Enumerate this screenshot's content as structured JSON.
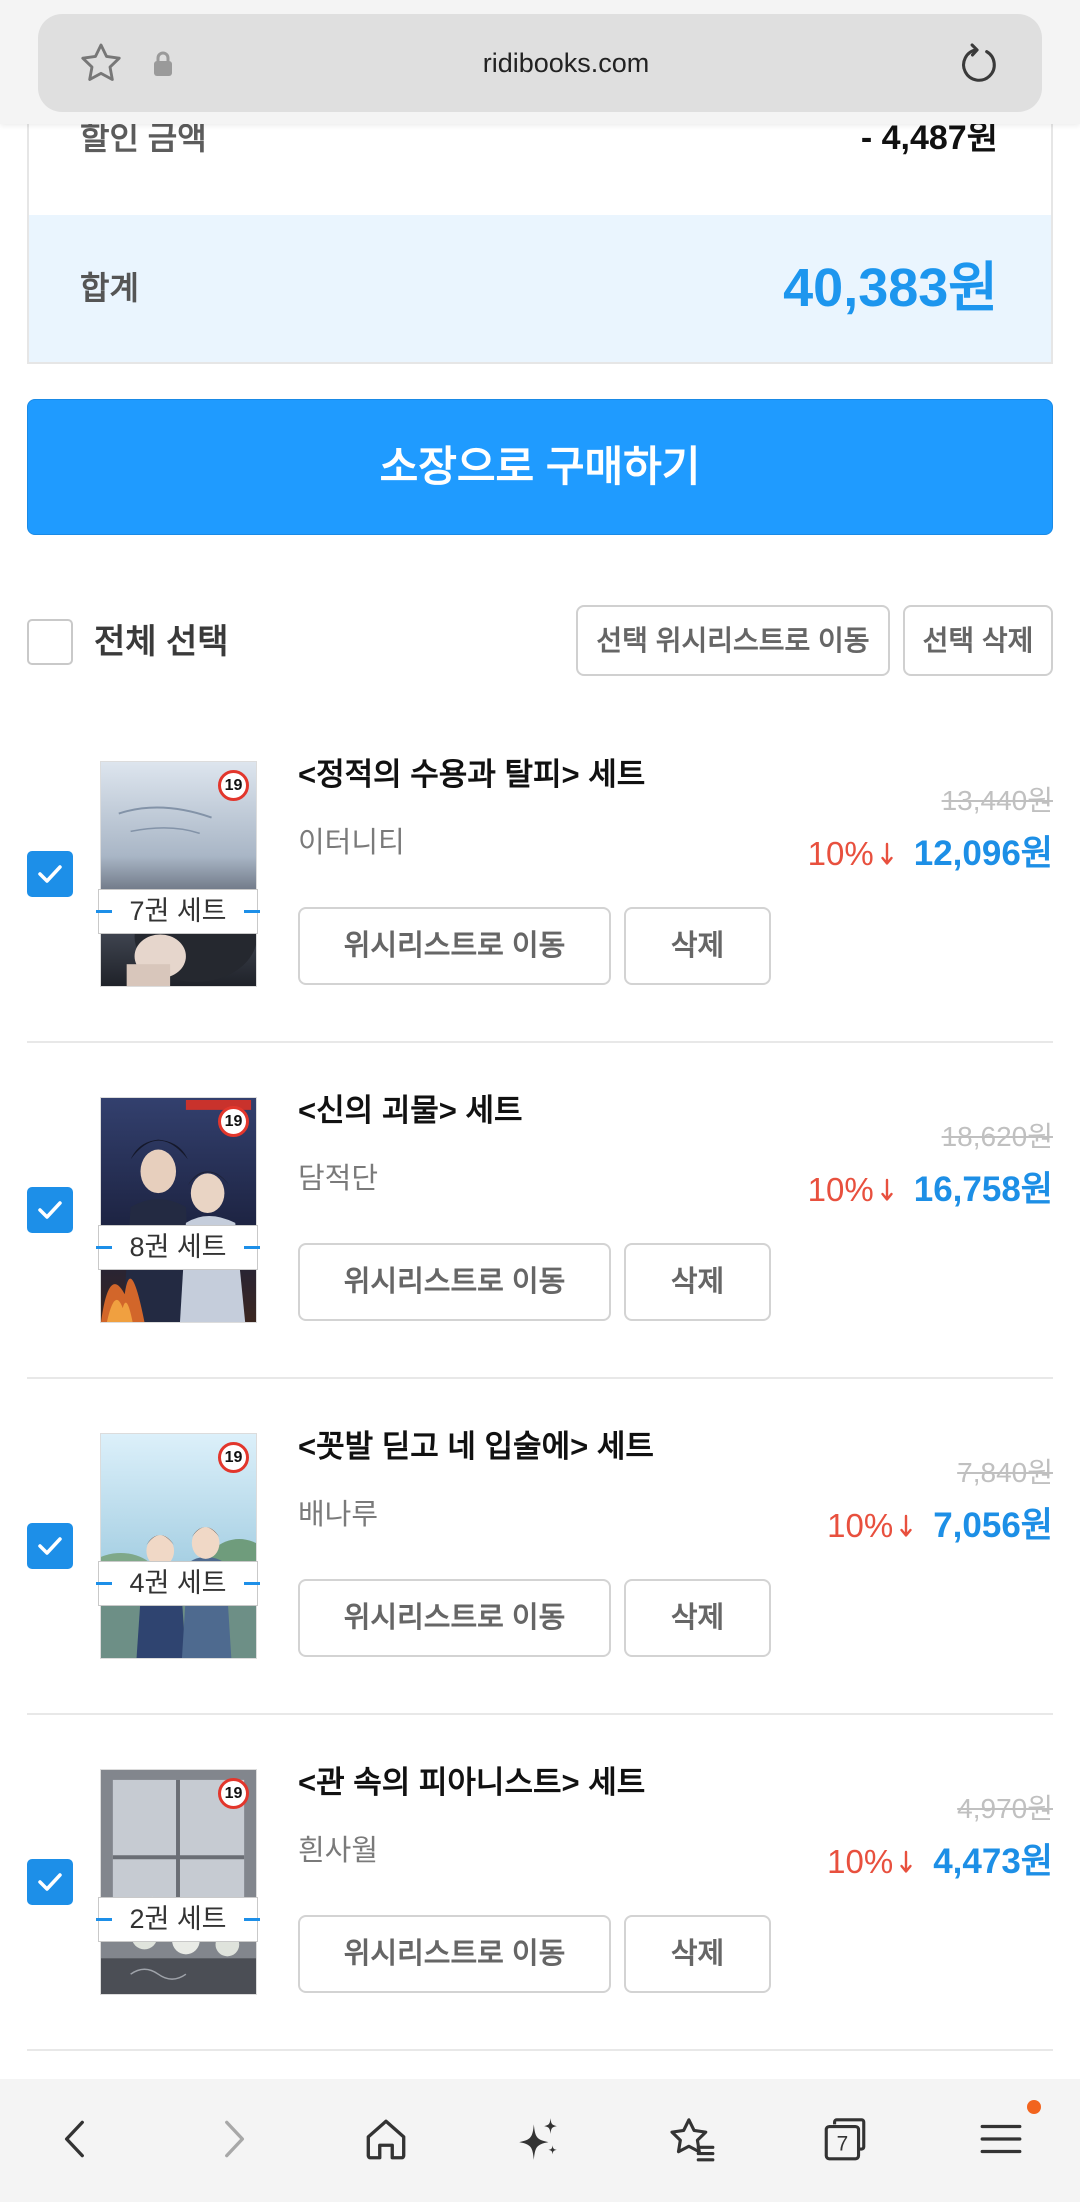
{
  "browser": {
    "url": "ridibooks.com",
    "tab_count": "7"
  },
  "summary": {
    "discount_label": "할인 금액",
    "discount_value": "- 4,487원",
    "total_label": "합계",
    "total_value": "40,383원"
  },
  "purchase_button": "소장으로 구매하기",
  "selection": {
    "select_all_label": "전체 선택",
    "select_all_checked": false,
    "move_selected_to_wishlist": "선택 위시리스트로 이동",
    "delete_selected": "선택 삭제"
  },
  "items": [
    {
      "title": "<정적의 수용과 탈피> 세트",
      "author": "이터니티",
      "set_label": "7권 세트",
      "age_rating": "19",
      "original_price": "13,440원",
      "discount_rate": "10%",
      "sale_price": "12,096원",
      "checked": true,
      "wishlist_button": "위시리스트로 이동",
      "delete_button": "삭제"
    },
    {
      "title": "<신의 괴물> 세트",
      "author": "담적단",
      "set_label": "8권 세트",
      "age_rating": "19",
      "original_price": "18,620원",
      "discount_rate": "10%",
      "sale_price": "16,758원",
      "checked": true,
      "wishlist_button": "위시리스트로 이동",
      "delete_button": "삭제"
    },
    {
      "title": "<꼿발 딛고 네 입술에> 세트",
      "author": "배나루",
      "set_label": "4권 세트",
      "age_rating": "19",
      "original_price": "7,840원",
      "discount_rate": "10%",
      "sale_price": "7,056원",
      "checked": true,
      "wishlist_button": "위시리스트로 이동",
      "delete_button": "삭제"
    },
    {
      "title": "<관 속의 피아니스트> 세트",
      "author": "흰사월",
      "set_label": "2권 세트",
      "age_rating": "19",
      "original_price": "4,970원",
      "discount_rate": "10%",
      "sale_price": "4,473원",
      "checked": true,
      "wishlist_button": "위시리스트로 이동",
      "delete_button": "삭제"
    }
  ],
  "icons": {
    "toolbar": [
      "bookmark-star-icon",
      "lock-icon",
      "reload-icon"
    ],
    "price": "down-arrow-icon",
    "bottom_nav": [
      "back-icon",
      "forward-icon",
      "home-icon",
      "sparkle-icon",
      "bookmarks-icon",
      "tabs-icon",
      "menu-icon"
    ]
  },
  "colors": {
    "accent_blue": "#1f9bff",
    "price_blue": "#1d8fe6",
    "discount_red": "#e8503e",
    "total_row_bg": "#eaf5fe",
    "checkbox_checked": "#1d8fe8",
    "notification_dot": "#f2641e"
  }
}
